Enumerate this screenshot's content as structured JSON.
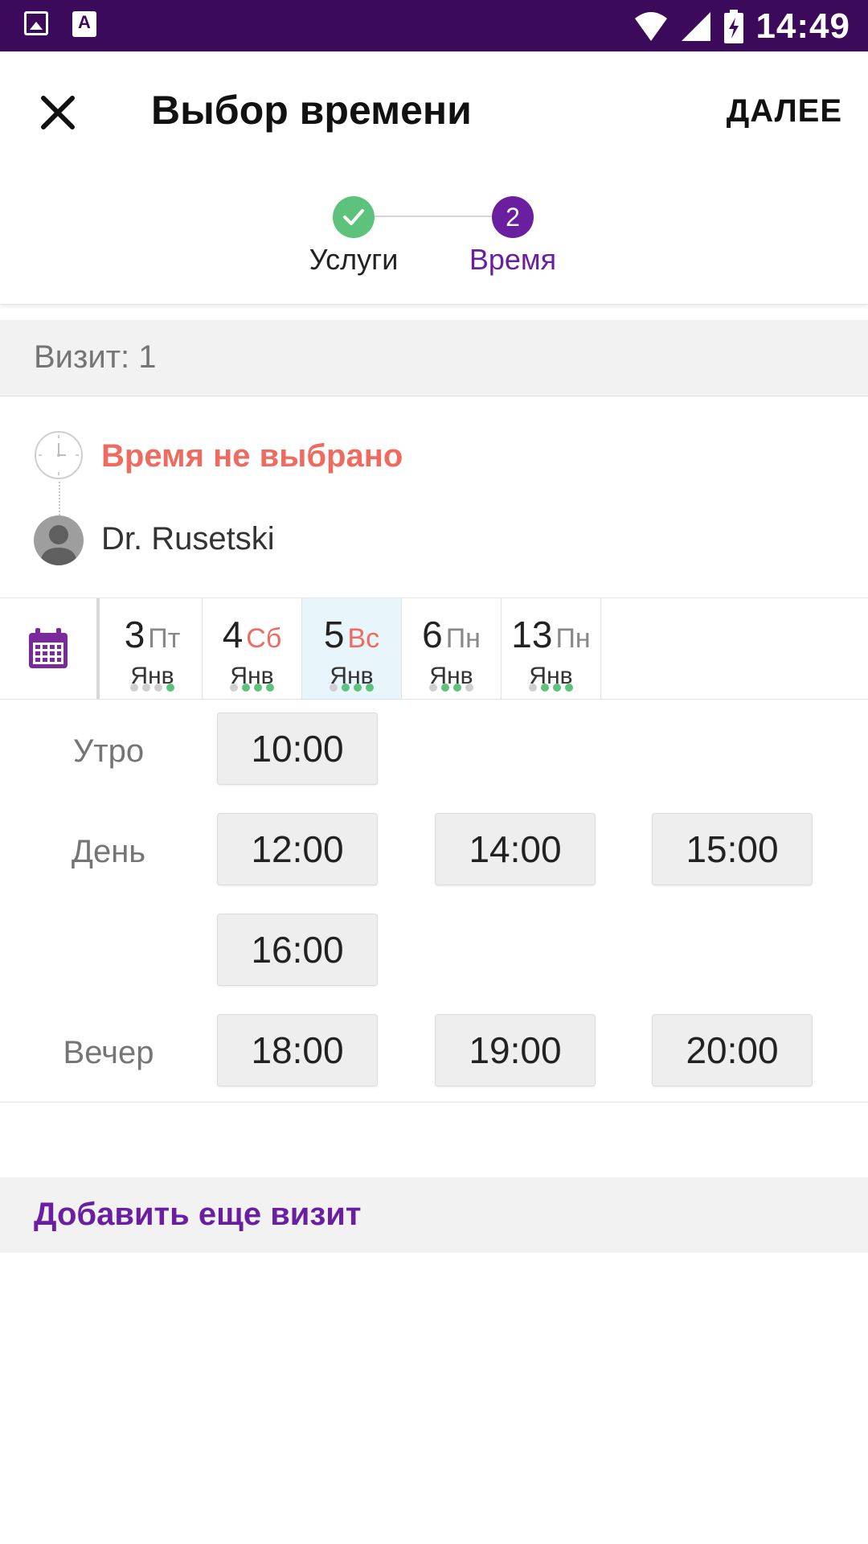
{
  "status_bar": {
    "time": "14:49",
    "icons": [
      "image-icon",
      "keyboard-a-icon",
      "wifi-icon",
      "signal-icon",
      "battery-charging-icon"
    ]
  },
  "app_bar": {
    "title": "Выбор времени",
    "next_label": "ДАЛЕЕ",
    "close_icon": "close-icon"
  },
  "stepper": {
    "steps": [
      {
        "label": "Услуги",
        "state": "done"
      },
      {
        "label": "Время",
        "number": "2",
        "state": "active"
      }
    ]
  },
  "visit": {
    "label": "Визит: 1",
    "time_status": "Время не выбрано",
    "doctor": "Dr. Rusetski"
  },
  "dates": [
    {
      "day": "3",
      "dow": "Пт",
      "month": "Янв",
      "weekend": false,
      "selected": false,
      "dots": [
        0,
        0,
        0,
        1
      ]
    },
    {
      "day": "4",
      "dow": "Сб",
      "month": "Янв",
      "weekend": true,
      "selected": false,
      "dots": [
        0,
        1,
        1,
        1
      ]
    },
    {
      "day": "5",
      "dow": "Вс",
      "month": "Янв",
      "weekend": true,
      "selected": true,
      "dots": [
        0,
        1,
        1,
        1
      ]
    },
    {
      "day": "6",
      "dow": "Пн",
      "month": "Янв",
      "weekend": false,
      "selected": false,
      "dots": [
        0,
        1,
        1,
        0
      ]
    },
    {
      "day": "13",
      "dow": "Пн",
      "month": "Янв",
      "weekend": false,
      "selected": false,
      "dots": [
        0,
        1,
        1,
        1
      ]
    }
  ],
  "periods": {
    "morning": "Утро",
    "day": "День",
    "evening": "Вечер"
  },
  "slots": {
    "morning": [
      "10:00"
    ],
    "day": [
      "12:00",
      "14:00",
      "15:00",
      "16:00"
    ],
    "evening": [
      "18:00",
      "19:00",
      "20:00"
    ]
  },
  "add_visit_label": "Добавить еще визит",
  "colors": {
    "accent": "#6a1fa0",
    "status_bar": "#3c0a5a",
    "success": "#5cc27c",
    "warning": "#ef6b5f",
    "selected_date_bg": "#e8f6fb"
  }
}
